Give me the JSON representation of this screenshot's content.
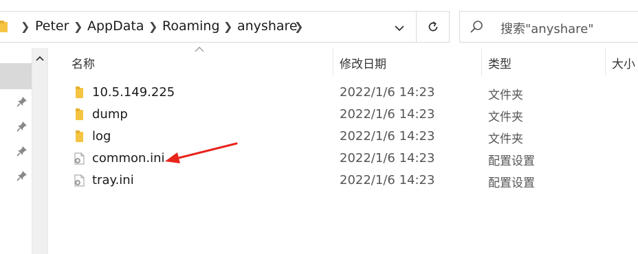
{
  "breadcrumb": {
    "items": [
      "Peter",
      "AppData",
      "Roaming",
      "anyshare"
    ]
  },
  "search": {
    "placeholder": "搜索\"anyshare\""
  },
  "columns": {
    "name": "名称",
    "date": "修改日期",
    "type": "类型",
    "size": "大小"
  },
  "files": [
    {
      "name": "10.5.149.225",
      "date": "2022/1/6 14:23",
      "type": "文件夹",
      "icon": "folder-icon"
    },
    {
      "name": "dump",
      "date": "2022/1/6 14:23",
      "type": "文件夹",
      "icon": "folder-icon"
    },
    {
      "name": "log",
      "date": "2022/1/6 14:23",
      "type": "文件夹",
      "icon": "folder-icon"
    },
    {
      "name": "common.ini",
      "date": "2022/1/6 14:23",
      "type": "配置设置",
      "icon": "config-file-icon"
    },
    {
      "name": "tray.ini",
      "date": "2022/1/6 14:23",
      "type": "配置设置",
      "icon": "config-file-icon"
    }
  ],
  "colors": {
    "folder": "#f5c443",
    "annotation_arrow": "#e8241b",
    "selected_nav": "#d9d9d9"
  }
}
